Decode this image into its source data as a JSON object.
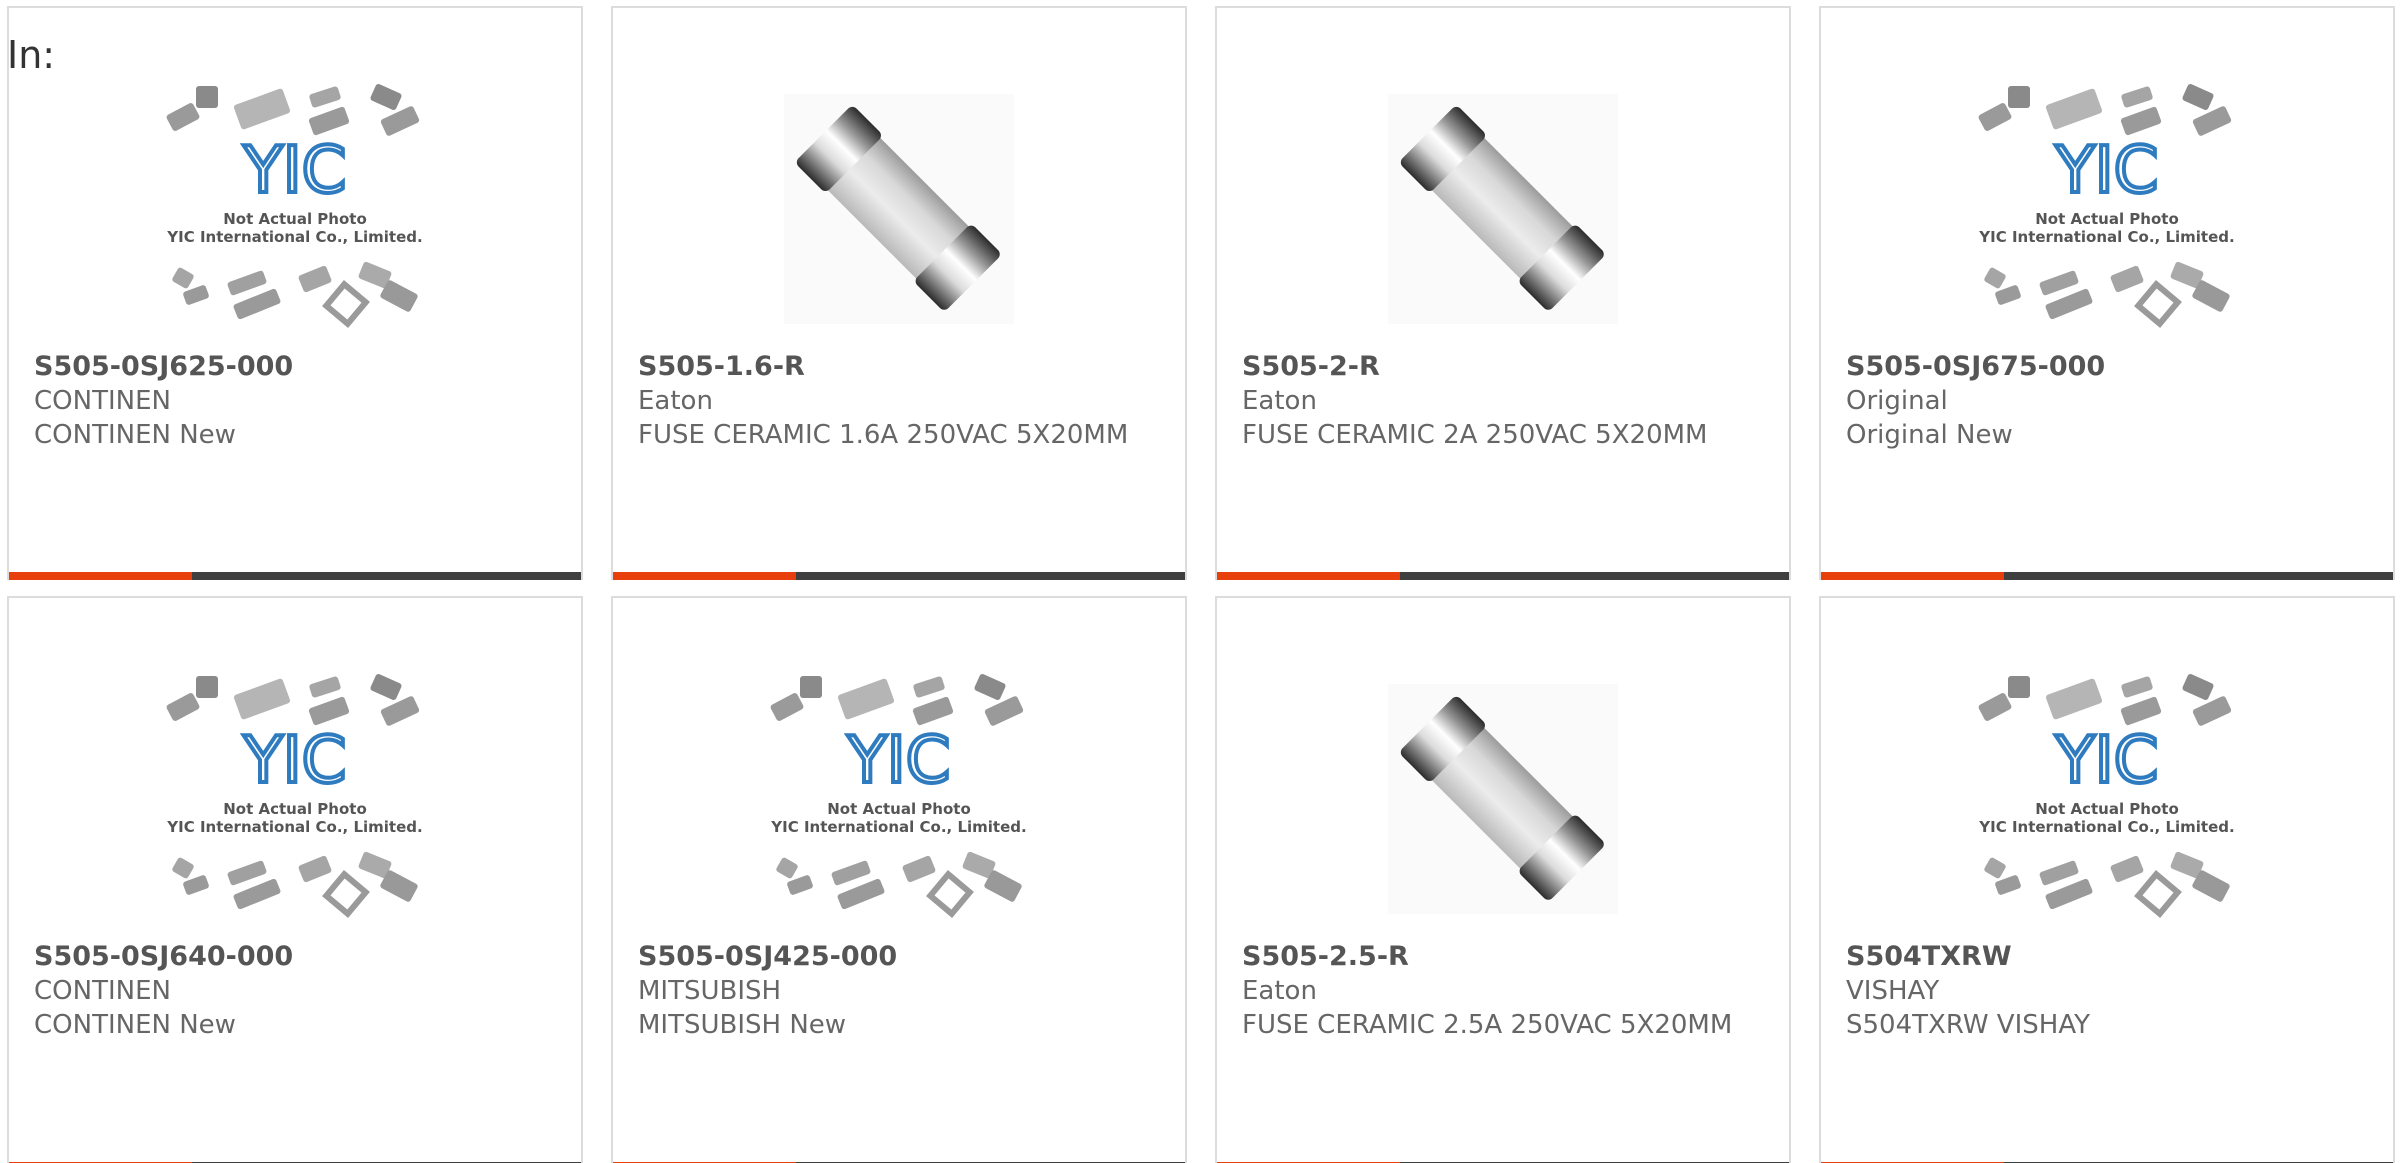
{
  "header": {
    "label": "In:"
  },
  "logo_text": {
    "brand": "YIC",
    "line1": "Not Actual Photo",
    "line2": "YIC International Co., Limited."
  },
  "colors": {
    "accent": "#e8400c",
    "bar_dark": "#3f3f3f",
    "text": "#666666",
    "logo_blue": "#2e7bbf"
  },
  "products": [
    {
      "part_number": "S505-0SJ625-000",
      "brand": "CONTINEN",
      "desc": "CONTINEN New",
      "image": "placeholder-logo"
    },
    {
      "part_number": "S505-1.6-R",
      "brand": "Eaton",
      "desc": "FUSE CERAMIC 1.6A 250VAC 5X20MM",
      "image": "fuse-photo"
    },
    {
      "part_number": "S505-2-R",
      "brand": "Eaton",
      "desc": "FUSE CERAMIC 2A 250VAC 5X20MM",
      "image": "fuse-photo"
    },
    {
      "part_number": "S505-0SJ675-000",
      "brand": "Original",
      "desc": "Original New",
      "image": "placeholder-logo"
    },
    {
      "part_number": "S505-0SJ640-000",
      "brand": "CONTINEN",
      "desc": "CONTINEN New",
      "image": "placeholder-logo"
    },
    {
      "part_number": "S505-0SJ425-000",
      "brand": "MITSUBISH",
      "desc": "MITSUBISH New",
      "image": "placeholder-logo"
    },
    {
      "part_number": "S505-2.5-R",
      "brand": "Eaton",
      "desc": "FUSE CERAMIC 2.5A 250VAC 5X20MM",
      "image": "fuse-photo"
    },
    {
      "part_number": "S504TXRW",
      "brand": "VISHAY",
      "desc": "S504TXRW VISHAY",
      "image": "placeholder-logo"
    }
  ]
}
